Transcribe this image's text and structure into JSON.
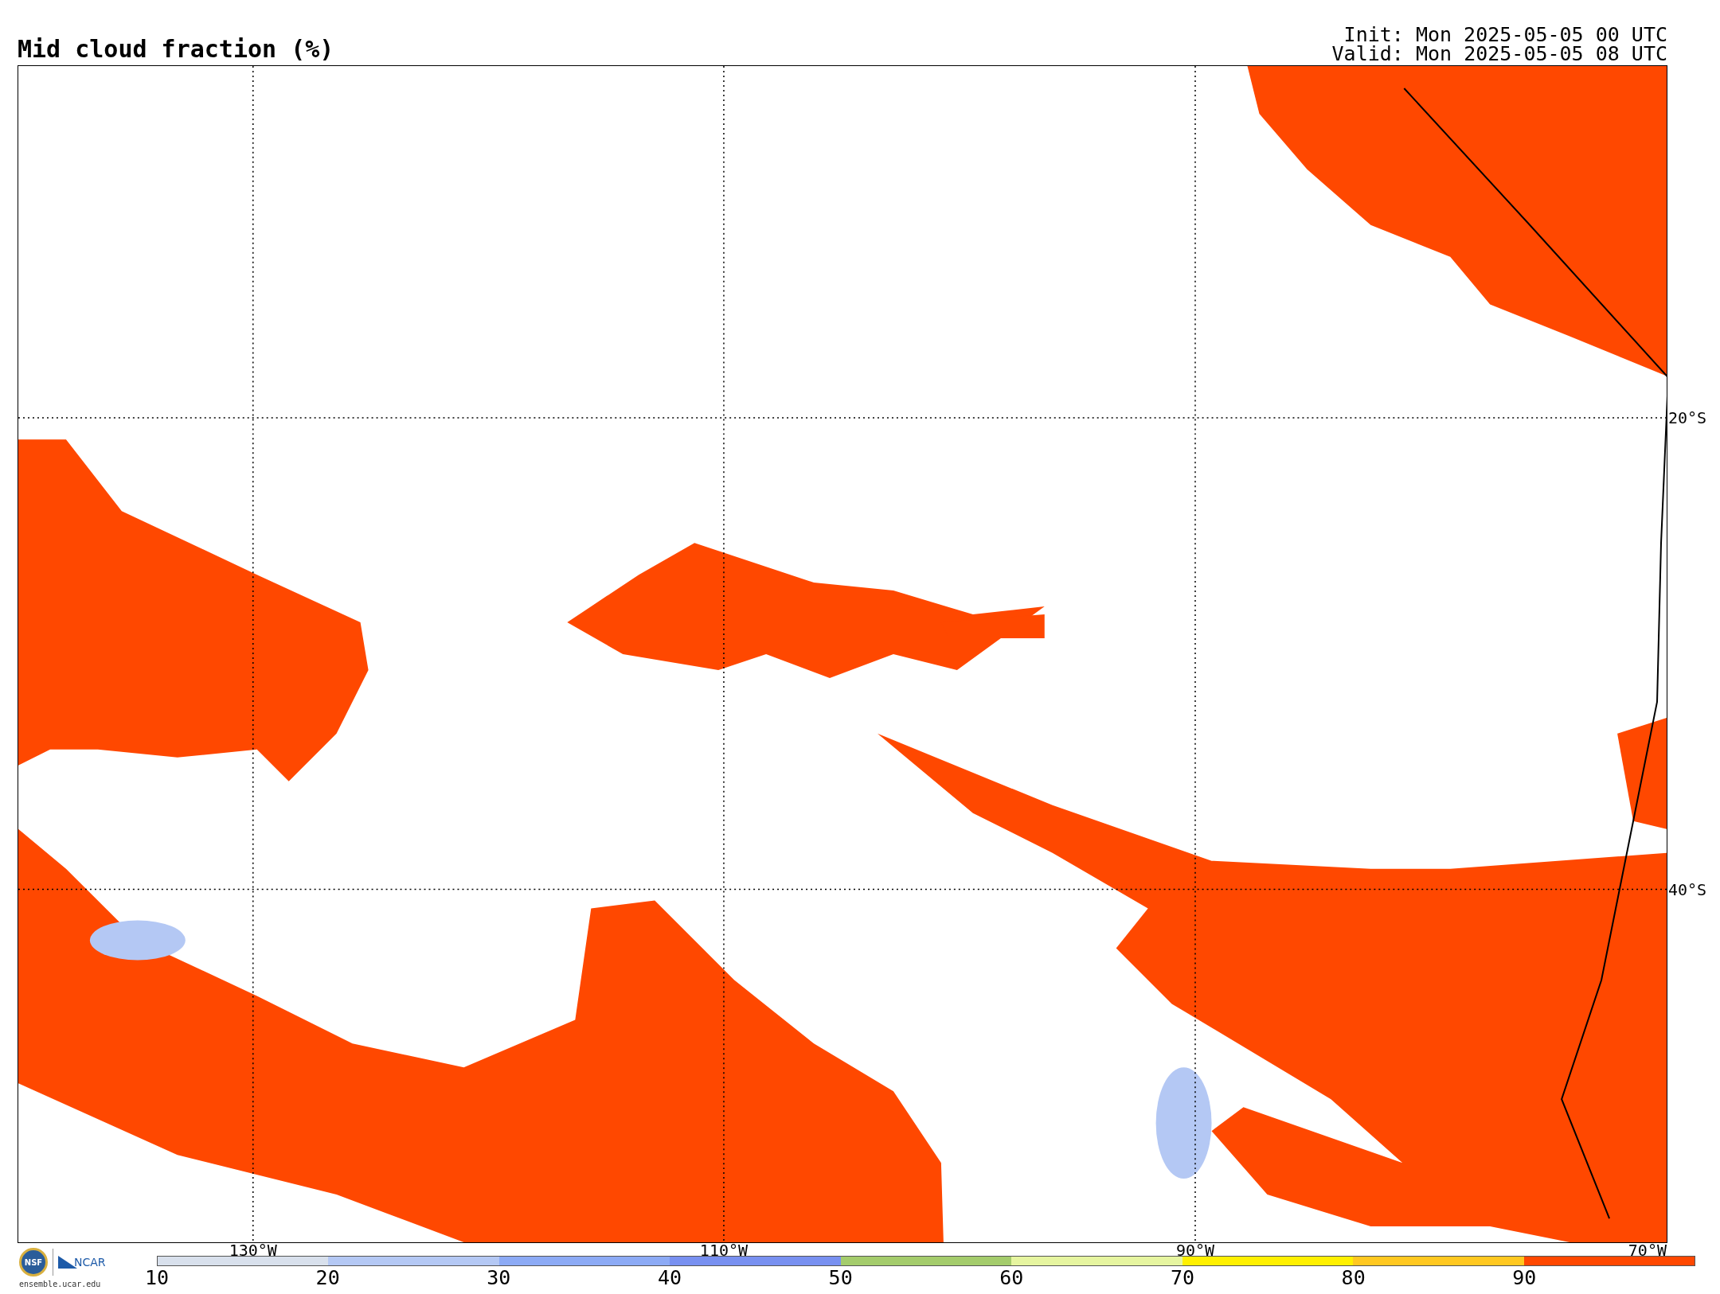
{
  "title": "Mid cloud fraction (%)",
  "init": "Init: Mon 2025-05-05 00 UTC",
  "valid": "Valid: Mon 2025-05-05 08 UTC",
  "map": {
    "lat_labels": [
      "20°S",
      "40°S"
    ],
    "lon_labels": [
      "130°W",
      "110°W",
      "90°W",
      "70°W"
    ]
  },
  "logos": {
    "nsf": "NSF",
    "ncar": "NCAR",
    "site": "ensemble.ucar.edu"
  },
  "colorbar": {
    "segments": [
      {
        "color": "#d8e0ec"
      },
      {
        "color": "#b4c8f4"
      },
      {
        "color": "#8caaf5"
      },
      {
        "color": "#7890f0"
      },
      {
        "color": "#a4cc6c"
      },
      {
        "color": "#e6f5a0"
      },
      {
        "color": "#fff000"
      },
      {
        "color": "#ffc820"
      },
      {
        "color": "#ff4800"
      }
    ],
    "ticks": [
      "10",
      "20",
      "30",
      "40",
      "50",
      "60",
      "70",
      "80",
      "90"
    ]
  }
}
